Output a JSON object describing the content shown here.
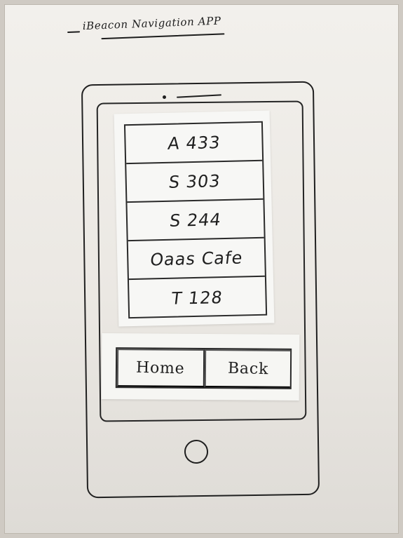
{
  "sketch": {
    "title": "iBeacon Navigation APP"
  },
  "list": {
    "items": [
      {
        "label": "A 433"
      },
      {
        "label": "S 303"
      },
      {
        "label": "S 244"
      },
      {
        "label": "Oaas Cafe"
      },
      {
        "label": "T 128"
      }
    ]
  },
  "buttons": {
    "home": "Home",
    "back": "Back"
  },
  "device": {
    "home_button_icon": "home-button-icon",
    "speaker_icon": "speaker-icon",
    "camera_icon": "camera-icon"
  }
}
